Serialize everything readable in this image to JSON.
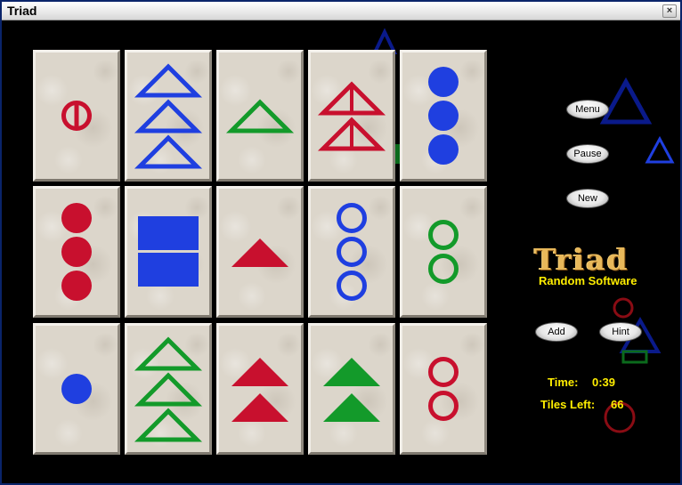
{
  "window": {
    "title": "Triad",
    "close_label": "×"
  },
  "controls": {
    "menu": "Menu",
    "pause": "Pause",
    "new": "New",
    "add": "Add",
    "hint": "Hint"
  },
  "branding": {
    "logo": "Triad",
    "subtitle": "Random Software"
  },
  "status": {
    "time_label": "Time:",
    "time_value": "0:39",
    "tiles_left_label": "Tiles Left:",
    "tiles_left_value": "66"
  },
  "colors": {
    "red": "#c8102e",
    "blue": "#1f3fe0",
    "green": "#139a2a",
    "navy": "#0a1a8a",
    "dark_red": "#8a0c14",
    "accent_yellow": "#ffee00"
  },
  "tiles": [
    {
      "shape": "circle",
      "fill": "striped",
      "color": "red",
      "count": 1
    },
    {
      "shape": "triangle",
      "fill": "empty",
      "color": "blue",
      "count": 3
    },
    {
      "shape": "triangle",
      "fill": "empty",
      "color": "green",
      "count": 1
    },
    {
      "shape": "triangle",
      "fill": "striped",
      "color": "red",
      "count": 2
    },
    {
      "shape": "circle",
      "fill": "solid",
      "color": "blue",
      "count": 3
    },
    {
      "shape": "circle",
      "fill": "solid",
      "color": "red",
      "count": 3
    },
    {
      "shape": "square",
      "fill": "solid",
      "color": "blue",
      "count": 2
    },
    {
      "shape": "triangle",
      "fill": "solid",
      "color": "red",
      "count": 1
    },
    {
      "shape": "circle",
      "fill": "empty",
      "color": "blue",
      "count": 3
    },
    {
      "shape": "circle",
      "fill": "empty",
      "color": "green",
      "count": 2
    },
    {
      "shape": "circle",
      "fill": "solid",
      "color": "blue",
      "count": 1
    },
    {
      "shape": "triangle",
      "fill": "empty",
      "color": "green",
      "count": 3
    },
    {
      "shape": "triangle",
      "fill": "solid",
      "color": "red",
      "count": 2
    },
    {
      "shape": "triangle",
      "fill": "solid",
      "color": "green",
      "count": 2
    },
    {
      "shape": "circle",
      "fill": "empty",
      "color": "red",
      "count": 2
    }
  ]
}
